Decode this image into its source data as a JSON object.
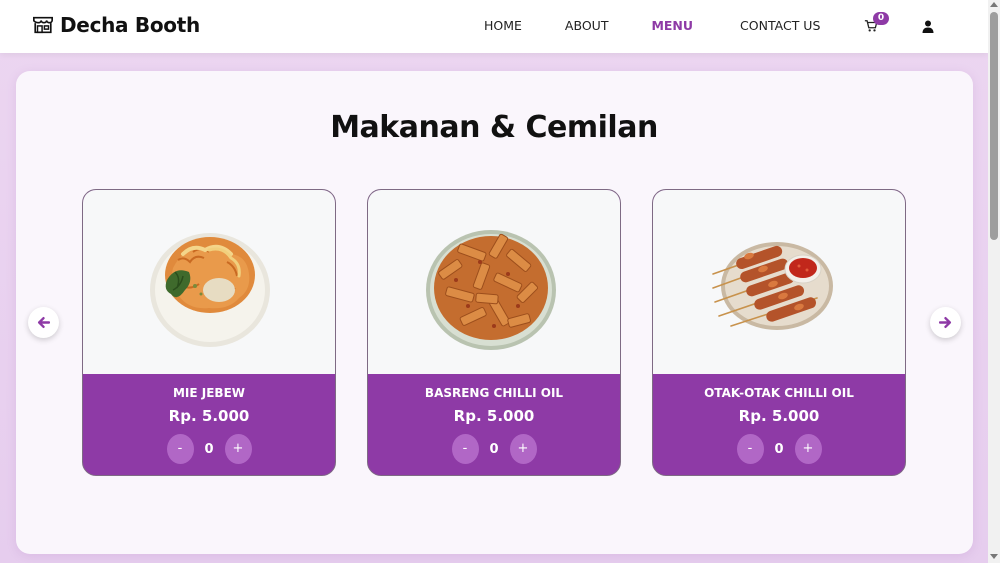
{
  "brand": {
    "name": "Decha Booth",
    "logo_icon": "shop-icon"
  },
  "nav": {
    "items": [
      {
        "label": "HOME",
        "active": false
      },
      {
        "label": "ABOUT",
        "active": false
      },
      {
        "label": "MENU",
        "active": true
      },
      {
        "label": "CONTACT US",
        "active": false
      }
    ],
    "cart_count": "0",
    "cart_icon": "cart-icon",
    "user_icon": "user-icon"
  },
  "section": {
    "title": "Makanan & Cemilan"
  },
  "products": [
    {
      "name": "MIE JEBEW",
      "price": "Rp. 5.000",
      "qty": "0",
      "minus": "-",
      "plus": "+"
    },
    {
      "name": "BASRENG CHILLI OIL",
      "price": "Rp. 5.000",
      "qty": "0",
      "minus": "-",
      "plus": "+"
    },
    {
      "name": "OTAK-OTAK CHILLI OIL",
      "price": "Rp. 5.000",
      "qty": "0",
      "minus": "-",
      "plus": "+"
    }
  ],
  "carousel": {
    "prev_icon": "arrow-left-icon",
    "next_icon": "arrow-right-icon"
  },
  "colors": {
    "accent": "#8e3aa6",
    "button": "#b167c6",
    "background": "#ecd6f1"
  }
}
